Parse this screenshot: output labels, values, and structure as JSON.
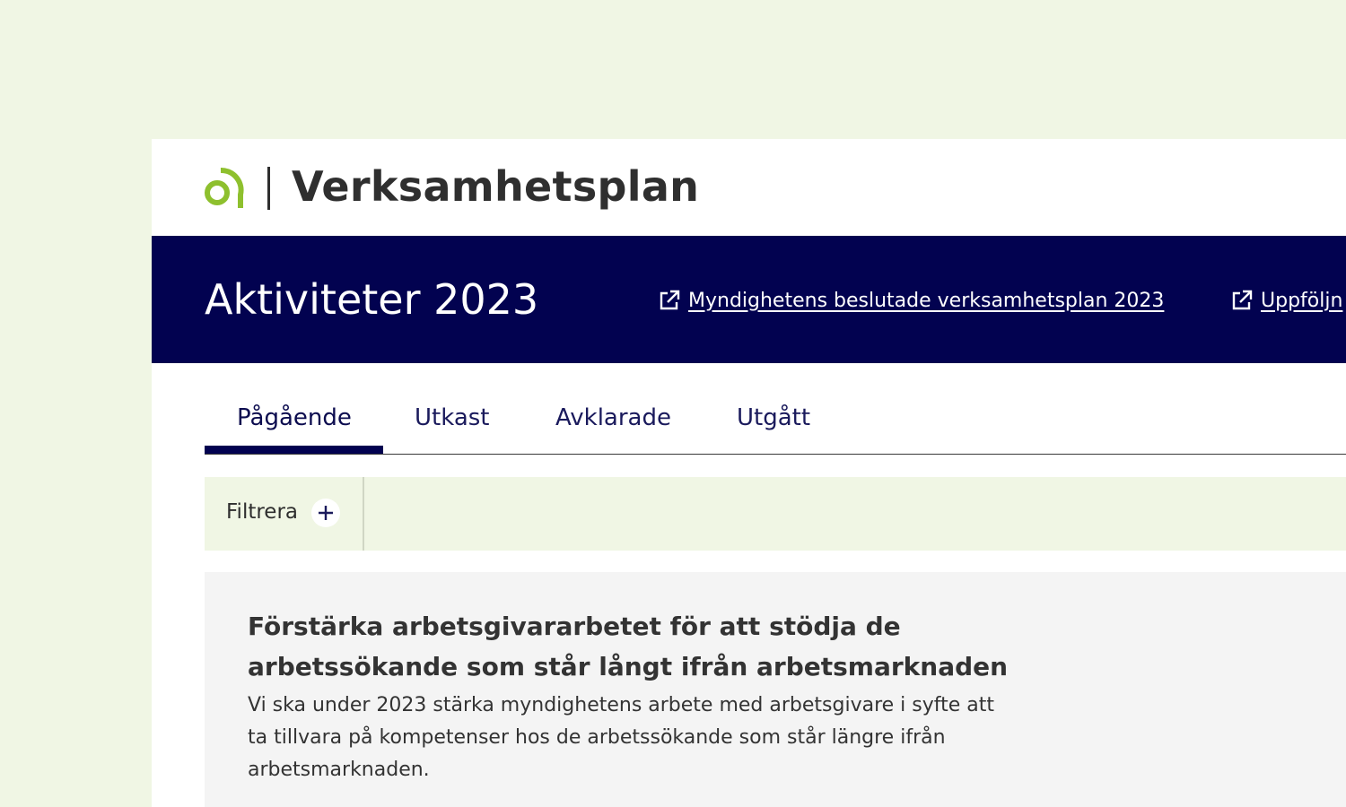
{
  "header": {
    "app_title": "Verksamhetsplan",
    "logo_icon": "arc-circle-logo",
    "logo_color": "#8ec02e"
  },
  "banner": {
    "title": "Aktiviteter 2023",
    "background": "#020250",
    "links": [
      {
        "label": "Myndighetens beslutade verksamhetsplan 2023",
        "icon": "external-link-icon"
      },
      {
        "label": "Uppföljn",
        "icon": "external-link-icon"
      }
    ]
  },
  "tabs": [
    {
      "label": "Pågående",
      "active": true
    },
    {
      "label": "Utkast",
      "active": false
    },
    {
      "label": "Avklarade",
      "active": false
    },
    {
      "label": "Utgått",
      "active": false
    }
  ],
  "filter": {
    "label": "Filtrera",
    "icon": "plus-icon"
  },
  "activity": {
    "title": "Förstärka arbetsgivararbetet för att stödja de arbetssökande som står långt ifrån arbetsmarknaden",
    "description": "Vi ska under 2023 stärka myndighetens arbete med arbetsgivare i syfte att ta tillvara på kompetenser hos de arbetssökande som står längre ifrån arbetsmarknaden."
  }
}
